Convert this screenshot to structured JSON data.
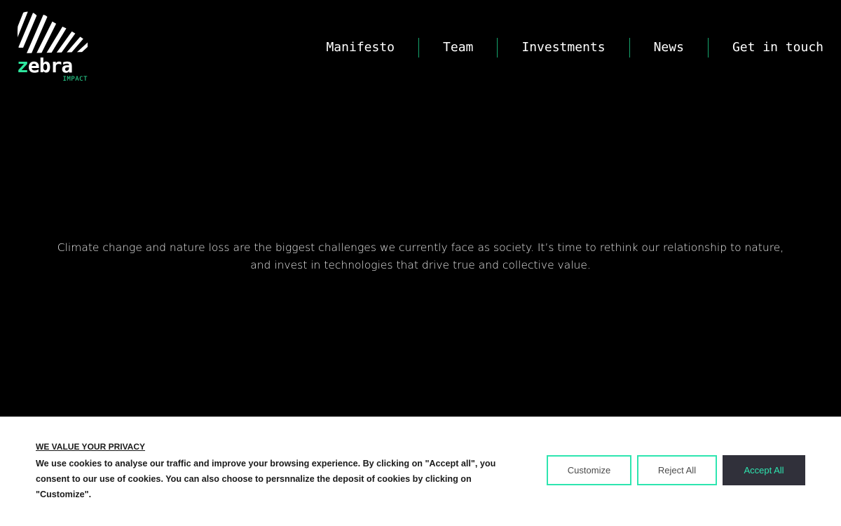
{
  "header": {
    "logo": {
      "word_z": "z",
      "word_rest": "ebra",
      "subtitle": "IMPACT",
      "accent_color": "#2ee59d"
    },
    "nav": [
      {
        "label": "Manifesto"
      },
      {
        "label": "Team"
      },
      {
        "label": "Investments"
      },
      {
        "label": "News"
      },
      {
        "label": "Get in touch"
      }
    ]
  },
  "hero": {
    "text": "Climate change and nature loss are the biggest challenges we currently face as society. It’s time to rethink our relationship to nature, and invest in technologies that drive true and collective value."
  },
  "cookie_banner": {
    "title": "WE VALUE YOUR PRIVACY",
    "text": "We use cookies to analyse our traffic and improve your browsing experience. By clicking on \"Accept all\", you consent to our use of cookies. You can also choose to persnnalize the deposit of cookies by clicking on \"Customize\".",
    "customize_label": "Customize",
    "reject_label": "Reject All",
    "accept_label": "Accept All",
    "accent_color": "#2ee5b0",
    "accept_bg": "#30303a"
  },
  "colors": {
    "background": "#000000",
    "nav_separator": "#16a56d"
  }
}
